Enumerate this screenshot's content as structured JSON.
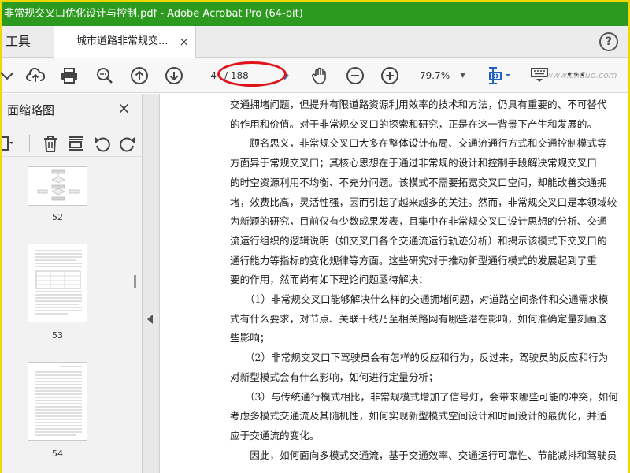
{
  "window": {
    "title": "非常规交叉口优化设计与控制.pdf - Adobe Acrobat Pro (64-bit)"
  },
  "tabs": {
    "tools_label": "工具",
    "document_label": "城市道路非常规交...",
    "close_symbol": "×",
    "help_symbol": "?"
  },
  "toolbar": {
    "page_current": "4",
    "page_total": "/ 188",
    "zoom": "79.7%",
    "more_symbol": "•••",
    "icons": [
      "chevron-icon",
      "cloud-upload-icon",
      "print-icon",
      "search-icon",
      "page-up-icon",
      "page-down-icon",
      "hand-tool-icon",
      "zoom-out-icon",
      "zoom-in-icon",
      "fit-page-icon",
      "keyboard-icon",
      "more-icon"
    ]
  },
  "watermark": "www.cnduo.com",
  "sidebar": {
    "title": "面缩略图",
    "close_symbol": "×",
    "icons": [
      "options-icon",
      "delete-icon",
      "extract-icon",
      "rotate-ccw-icon",
      "rotate-cw-icon"
    ],
    "thumbnails": [
      {
        "label": "52"
      },
      {
        "label": "53"
      },
      {
        "label": "54"
      }
    ]
  },
  "document": {
    "lines": [
      "交通拥堵问题，但提升有限道路资源利用效率的技术和方法，仍具有重要的、不可替代",
      "的作用和价值。对于非常规交叉口的探索和研究，正是在这一背景下产生和发展的。",
      "　　顾名思义，非常规交叉口大多在整体设计布局、交通流通行方式和交通控制模式等",
      "方面异于常规交叉口；其核心思想在于通过非常规的设计和控制手段解决常规交叉口",
      "的时空资源利用不均衡、不充分问题。该模式不需要拓宽交叉口空间，却能改善交通拥",
      "堵，效费比高，灵活性强，因而引起了越来越多的关注。然而，非常规交叉口是本领域较",
      "为新颖的研究，目前仅有少数成果发表，且集中在非常规交叉口设计思想的分析、交通",
      "流运行组织的逻辑说明（如交叉口各个交通流运行轨迹分析）和揭示该模式下交叉口的",
      "通行能力等指标的变化规律等方面。这些研究对于推动新型通行模式的发展起到了重",
      "要的作用，然而尚有如下理论问题亟待解决：",
      "　　（1）非常规交叉口能够解决什么样的交通拥堵问题，对道路空间条件和交通需求模",
      "式有什么要求，对节点、关联干线乃至相关路网有哪些潜在影响，如何准确定量刻画这",
      "些影响；",
      "　　（2）非常规交叉口下驾驶员会有怎样的反应和行为，反过来，驾驶员的反应和行为",
      "对新型模式会有什么影响，如何进行定量分析；",
      "　　（3）与传统通行模式相比，非常规模式增加了信号灯，会带来哪些可能的冲突，如何",
      "考虑多模式交通流及其随机性，如何实现新型模式空间设计和时间设计的最优化，并适",
      "应于交通流的变化。",
      "　　因此，如何面向多模式交通流，基于交通效率、交通运行可靠性、节能减排和驾驶员"
    ]
  },
  "colors": {
    "titlebar": "#2b9a1e",
    "highlight_ellipse": "#e0131b",
    "border": "#f2d600"
  }
}
